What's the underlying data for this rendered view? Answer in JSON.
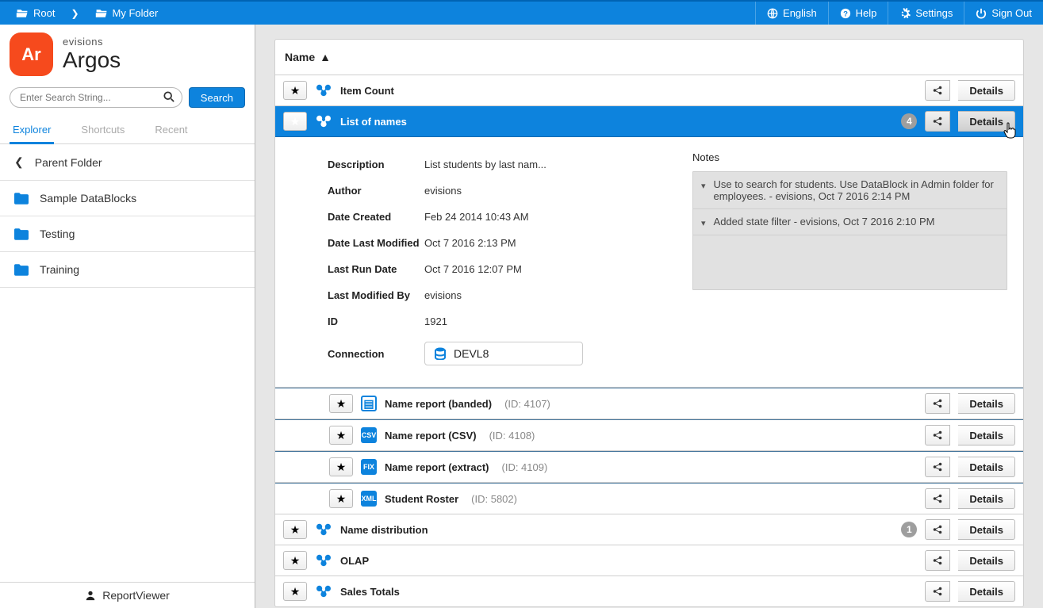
{
  "topbar": {
    "breadcrumb_root": "Root",
    "breadcrumb_current": "My Folder",
    "english": "English",
    "help": "Help",
    "settings": "Settings",
    "signout": "Sign Out"
  },
  "brand": {
    "badge": "Ar",
    "small": "evisions",
    "big": "Argos"
  },
  "search": {
    "placeholder": "Enter Search String...",
    "button": "Search"
  },
  "sideTabs": {
    "explorer": "Explorer",
    "shortcuts": "Shortcuts",
    "recent": "Recent"
  },
  "folders": {
    "parent": "Parent Folder",
    "items": [
      {
        "label": "Sample DataBlocks"
      },
      {
        "label": "Testing"
      },
      {
        "label": "Training"
      }
    ]
  },
  "footer": {
    "user": "ReportViewer"
  },
  "list": {
    "header": "Name",
    "detailsLabel": "Details",
    "rows": {
      "item_count": "Item Count",
      "list_of_names": "List of names",
      "name_dist": "Name distribution",
      "olap": "OLAP",
      "sales_totals": "Sales Totals"
    },
    "badges": {
      "list_of_names": "4",
      "name_dist": "1"
    }
  },
  "details": {
    "labels": {
      "description": "Description",
      "author": "Author",
      "created": "Date Created",
      "modified": "Date Last Modified",
      "lastrun": "Last Run Date",
      "modby": "Last Modified By",
      "id": "ID",
      "connection": "Connection"
    },
    "values": {
      "description": "List students by last nam...",
      "author": "evisions",
      "created": "Feb 24 2014 10:43 AM",
      "modified": "Oct 7 2016 2:13 PM",
      "lastrun": "Oct 7 2016 12:07 PM",
      "modby": "evisions",
      "id": "1921",
      "connection": "DEVL8"
    },
    "notesTitle": "Notes",
    "notes": [
      "Use to search for students. Use DataBlock in Admin folder for employees. - evisions, Oct 7 2016 2:14 PM",
      "Added state filter - evisions, Oct 7 2016 2:10 PM"
    ]
  },
  "subreports": [
    {
      "name": "Name report (banded)",
      "id": "(ID: 4107)",
      "kind": "doc"
    },
    {
      "name": "Name report (CSV)",
      "id": "(ID: 4108)",
      "kind": "csv"
    },
    {
      "name": "Name report (extract)",
      "id": "(ID: 4109)",
      "kind": "fix"
    },
    {
      "name": "Student Roster",
      "id": "(ID: 5802)",
      "kind": "xml"
    }
  ]
}
